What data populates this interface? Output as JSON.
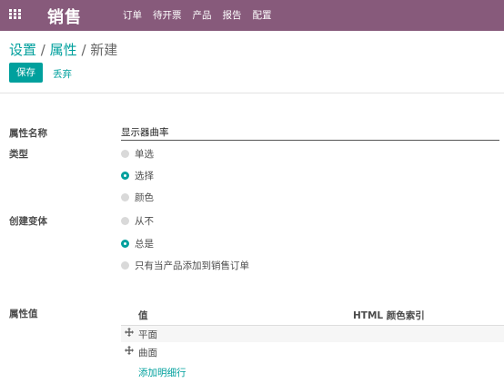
{
  "topbar": {
    "app_name": "销售",
    "menu": [
      "订单",
      "待开票",
      "产品",
      "报告",
      "配置"
    ]
  },
  "breadcrumb": {
    "part1": "设置",
    "part2": "属性",
    "current": "新建",
    "sep": "/"
  },
  "buttons": {
    "save": "保存",
    "discard": "丢弃"
  },
  "form": {
    "name_label": "属性名称",
    "name_value": "显示器曲率",
    "type_label": "类型",
    "type_options": [
      "单选",
      "选择",
      "颜色"
    ],
    "type_selected": "选择",
    "variant_label": "创建变体",
    "variant_options": [
      "从不",
      "总是",
      "只有当产品添加到销售订单"
    ],
    "variant_selected": "总是",
    "values_label": "属性值"
  },
  "values_table": {
    "col_value": "值",
    "col_color": "HTML 颜色索引",
    "rows": [
      "平面",
      "曲面"
    ],
    "add_line": "添加明细行"
  },
  "colors": {
    "brand": "#875a7b",
    "accent": "#00a09d"
  }
}
